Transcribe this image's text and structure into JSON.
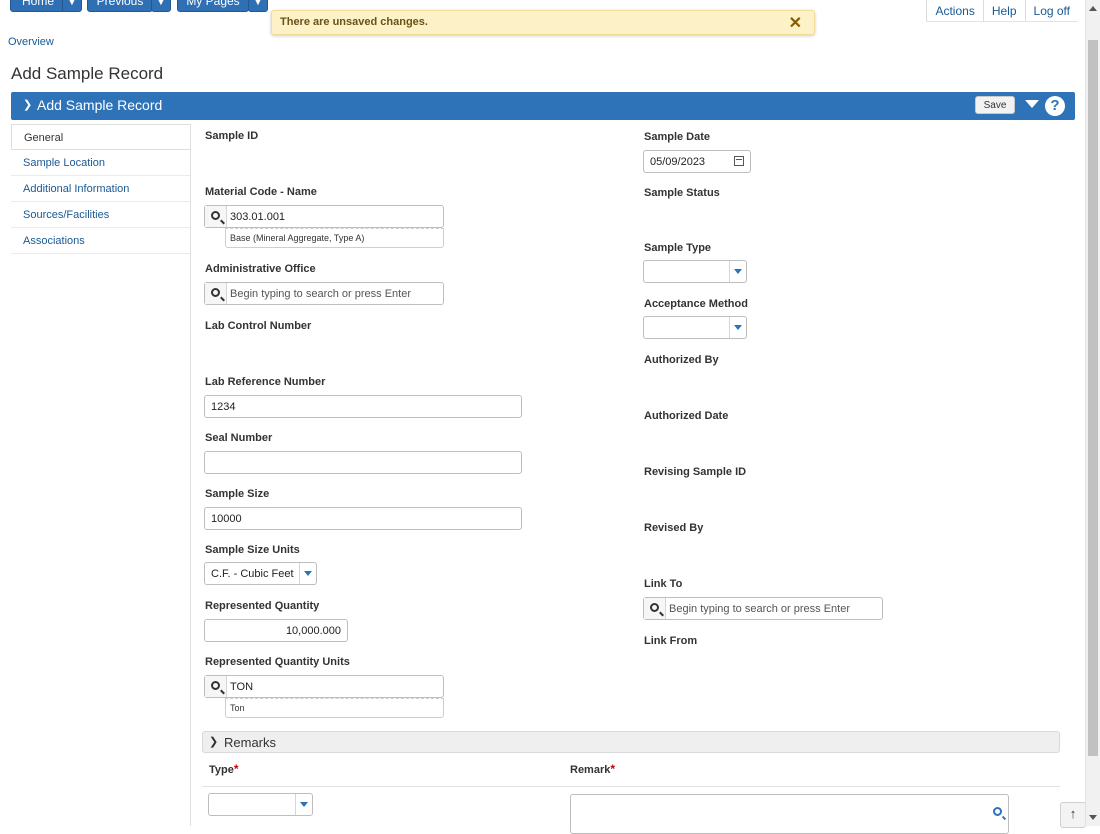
{
  "topnav": {
    "home": "Home",
    "previous": "Previous",
    "my_pages": "My Pages",
    "links": [
      "Actions",
      "Help",
      "Log off"
    ]
  },
  "alert": {
    "message": "There are unsaved changes.",
    "close": "✕"
  },
  "breadcrumb": "Overview",
  "page_title": "Add Sample Record",
  "panel": {
    "title": "Add Sample Record",
    "save_label": "Save",
    "help": "?"
  },
  "sidebar": {
    "items": [
      {
        "label": "General"
      },
      {
        "label": "Sample Location"
      },
      {
        "label": "Additional Information"
      },
      {
        "label": "Sources/Facilities"
      },
      {
        "label": "Associations"
      }
    ]
  },
  "left": {
    "sample_id_label": "Sample ID",
    "material_label": "Material Code - Name",
    "material_value": "303.01.001",
    "material_desc": "Base (Mineral Aggregate, Type A)",
    "admin_office_label": "Administrative Office",
    "admin_office_placeholder": "Begin typing to search or press Enter",
    "lab_control_label": "Lab Control Number",
    "lab_ref_label": "Lab Reference Number",
    "lab_ref_value": "1234",
    "seal_label": "Seal Number",
    "seal_value": "",
    "sample_size_label": "Sample Size",
    "sample_size_value": "10000",
    "size_units_label": "Sample Size Units",
    "size_units_value": "C.F. - Cubic Feet",
    "rep_qty_label": "Represented Quantity",
    "rep_qty_value": "10,000.000",
    "rep_qty_units_label": "Represented Quantity Units",
    "rep_qty_units_value": "TON",
    "rep_qty_units_desc": "Ton"
  },
  "right": {
    "sample_date_label": "Sample Date",
    "sample_date_value": "05/09/2023",
    "sample_status_label": "Sample Status",
    "sample_type_label": "Sample Type",
    "sample_type_value": "",
    "acceptance_label": "Acceptance Method",
    "acceptance_value": "",
    "authorized_by_label": "Authorized By",
    "authorized_date_label": "Authorized Date",
    "revising_label": "Revising Sample ID",
    "revised_by_label": "Revised By",
    "link_to_label": "Link To",
    "link_to_placeholder": "Begin typing to search or press Enter",
    "link_from_label": "Link From"
  },
  "remarks": {
    "title": "Remarks",
    "type_col": "Type",
    "remark_col": "Remark",
    "required_mark": "*",
    "type_value": ""
  },
  "scroll_top": "↑"
}
